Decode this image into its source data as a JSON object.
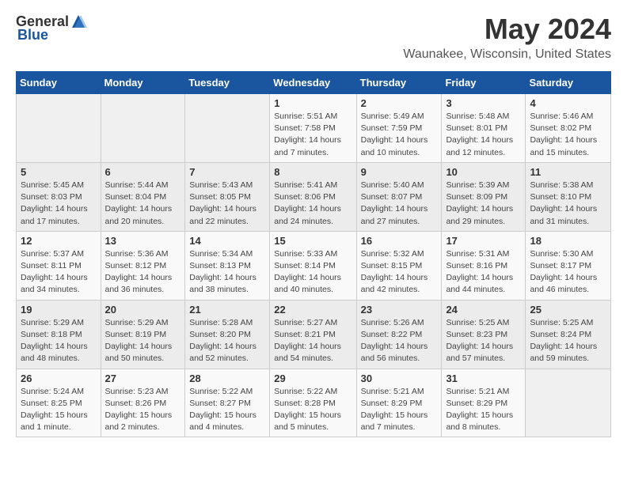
{
  "header": {
    "logo_general": "General",
    "logo_blue": "Blue",
    "month_year": "May 2024",
    "location": "Waunakee, Wisconsin, United States"
  },
  "weekdays": [
    "Sunday",
    "Monday",
    "Tuesday",
    "Wednesday",
    "Thursday",
    "Friday",
    "Saturday"
  ],
  "weeks": [
    [
      {
        "num": "",
        "details": ""
      },
      {
        "num": "",
        "details": ""
      },
      {
        "num": "",
        "details": ""
      },
      {
        "num": "1",
        "details": "Sunrise: 5:51 AM\nSunset: 7:58 PM\nDaylight: 14 hours\nand 7 minutes."
      },
      {
        "num": "2",
        "details": "Sunrise: 5:49 AM\nSunset: 7:59 PM\nDaylight: 14 hours\nand 10 minutes."
      },
      {
        "num": "3",
        "details": "Sunrise: 5:48 AM\nSunset: 8:01 PM\nDaylight: 14 hours\nand 12 minutes."
      },
      {
        "num": "4",
        "details": "Sunrise: 5:46 AM\nSunset: 8:02 PM\nDaylight: 14 hours\nand 15 minutes."
      }
    ],
    [
      {
        "num": "5",
        "details": "Sunrise: 5:45 AM\nSunset: 8:03 PM\nDaylight: 14 hours\nand 17 minutes."
      },
      {
        "num": "6",
        "details": "Sunrise: 5:44 AM\nSunset: 8:04 PM\nDaylight: 14 hours\nand 20 minutes."
      },
      {
        "num": "7",
        "details": "Sunrise: 5:43 AM\nSunset: 8:05 PM\nDaylight: 14 hours\nand 22 minutes."
      },
      {
        "num": "8",
        "details": "Sunrise: 5:41 AM\nSunset: 8:06 PM\nDaylight: 14 hours\nand 24 minutes."
      },
      {
        "num": "9",
        "details": "Sunrise: 5:40 AM\nSunset: 8:07 PM\nDaylight: 14 hours\nand 27 minutes."
      },
      {
        "num": "10",
        "details": "Sunrise: 5:39 AM\nSunset: 8:09 PM\nDaylight: 14 hours\nand 29 minutes."
      },
      {
        "num": "11",
        "details": "Sunrise: 5:38 AM\nSunset: 8:10 PM\nDaylight: 14 hours\nand 31 minutes."
      }
    ],
    [
      {
        "num": "12",
        "details": "Sunrise: 5:37 AM\nSunset: 8:11 PM\nDaylight: 14 hours\nand 34 minutes."
      },
      {
        "num": "13",
        "details": "Sunrise: 5:36 AM\nSunset: 8:12 PM\nDaylight: 14 hours\nand 36 minutes."
      },
      {
        "num": "14",
        "details": "Sunrise: 5:34 AM\nSunset: 8:13 PM\nDaylight: 14 hours\nand 38 minutes."
      },
      {
        "num": "15",
        "details": "Sunrise: 5:33 AM\nSunset: 8:14 PM\nDaylight: 14 hours\nand 40 minutes."
      },
      {
        "num": "16",
        "details": "Sunrise: 5:32 AM\nSunset: 8:15 PM\nDaylight: 14 hours\nand 42 minutes."
      },
      {
        "num": "17",
        "details": "Sunrise: 5:31 AM\nSunset: 8:16 PM\nDaylight: 14 hours\nand 44 minutes."
      },
      {
        "num": "18",
        "details": "Sunrise: 5:30 AM\nSunset: 8:17 PM\nDaylight: 14 hours\nand 46 minutes."
      }
    ],
    [
      {
        "num": "19",
        "details": "Sunrise: 5:29 AM\nSunset: 8:18 PM\nDaylight: 14 hours\nand 48 minutes."
      },
      {
        "num": "20",
        "details": "Sunrise: 5:29 AM\nSunset: 8:19 PM\nDaylight: 14 hours\nand 50 minutes."
      },
      {
        "num": "21",
        "details": "Sunrise: 5:28 AM\nSunset: 8:20 PM\nDaylight: 14 hours\nand 52 minutes."
      },
      {
        "num": "22",
        "details": "Sunrise: 5:27 AM\nSunset: 8:21 PM\nDaylight: 14 hours\nand 54 minutes."
      },
      {
        "num": "23",
        "details": "Sunrise: 5:26 AM\nSunset: 8:22 PM\nDaylight: 14 hours\nand 56 minutes."
      },
      {
        "num": "24",
        "details": "Sunrise: 5:25 AM\nSunset: 8:23 PM\nDaylight: 14 hours\nand 57 minutes."
      },
      {
        "num": "25",
        "details": "Sunrise: 5:25 AM\nSunset: 8:24 PM\nDaylight: 14 hours\nand 59 minutes."
      }
    ],
    [
      {
        "num": "26",
        "details": "Sunrise: 5:24 AM\nSunset: 8:25 PM\nDaylight: 15 hours\nand 1 minute."
      },
      {
        "num": "27",
        "details": "Sunrise: 5:23 AM\nSunset: 8:26 PM\nDaylight: 15 hours\nand 2 minutes."
      },
      {
        "num": "28",
        "details": "Sunrise: 5:22 AM\nSunset: 8:27 PM\nDaylight: 15 hours\nand 4 minutes."
      },
      {
        "num": "29",
        "details": "Sunrise: 5:22 AM\nSunset: 8:28 PM\nDaylight: 15 hours\nand 5 minutes."
      },
      {
        "num": "30",
        "details": "Sunrise: 5:21 AM\nSunset: 8:29 PM\nDaylight: 15 hours\nand 7 minutes."
      },
      {
        "num": "31",
        "details": "Sunrise: 5:21 AM\nSunset: 8:29 PM\nDaylight: 15 hours\nand 8 minutes."
      },
      {
        "num": "",
        "details": ""
      }
    ]
  ]
}
